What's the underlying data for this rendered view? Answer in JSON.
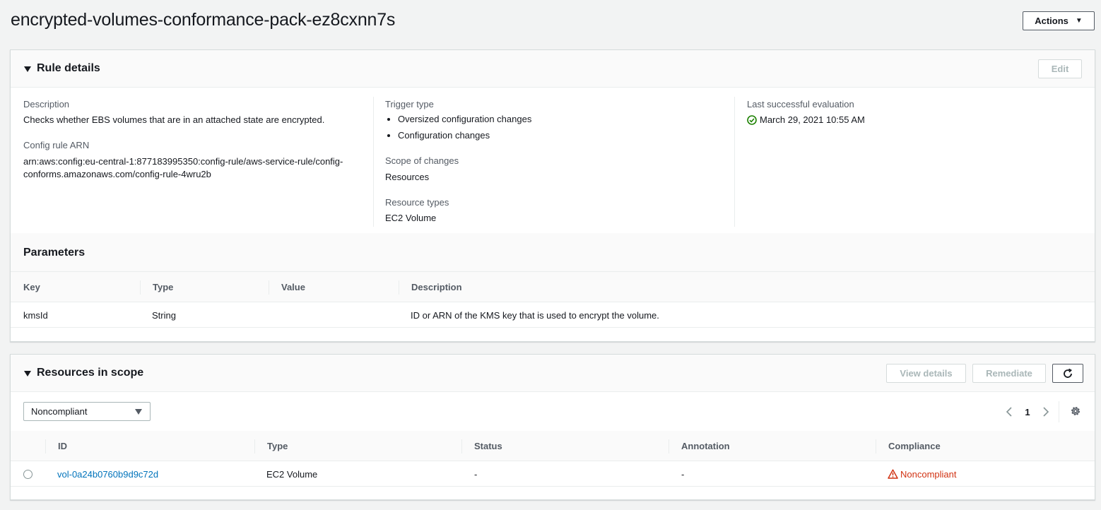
{
  "header": {
    "title": "encrypted-volumes-conformance-pack-ez8cxnn7s",
    "actions_label": "Actions"
  },
  "rule_details": {
    "title": "Rule details",
    "edit_label": "Edit",
    "description_label": "Description",
    "description_value": "Checks whether EBS volumes that are in an attached state are encrypted.",
    "arn_label": "Config rule ARN",
    "arn_line1": "arn:aws:config:eu-central-1:877183995350:config-rule/aws-service-rule/config-",
    "arn_line2": "conforms.amazonaws.com/config-rule-4wru2b",
    "trigger_label": "Trigger type",
    "trigger_items": [
      "Oversized configuration changes",
      "Configuration changes"
    ],
    "scope_label": "Scope of changes",
    "scope_value": "Resources",
    "resource_types_label": "Resource types",
    "resource_types_value": "EC2 Volume",
    "last_eval_label": "Last successful evaluation",
    "last_eval_value": "March 29, 2021 10:55 AM"
  },
  "parameters": {
    "title": "Parameters",
    "columns": [
      "Key",
      "Type",
      "Value",
      "Description"
    ],
    "rows": [
      {
        "key": "kmsId",
        "type": "String",
        "value": "",
        "description": "ID or ARN of the KMS key that is used to encrypt the volume."
      }
    ]
  },
  "resources": {
    "title": "Resources in scope",
    "view_details_label": "View details",
    "remediate_label": "Remediate",
    "filter_value": "Noncompliant",
    "page_number": "1",
    "columns": [
      "ID",
      "Type",
      "Status",
      "Annotation",
      "Compliance"
    ],
    "rows": [
      {
        "id": "vol-0a24b0760b9d9c72d",
        "type": "EC2 Volume",
        "status": "-",
        "annotation": "-",
        "compliance": "Noncompliant"
      }
    ]
  },
  "colors": {
    "link": "#0073bb",
    "error": "#d13212",
    "success": "#1d8102",
    "background": "#f2f3f3"
  }
}
